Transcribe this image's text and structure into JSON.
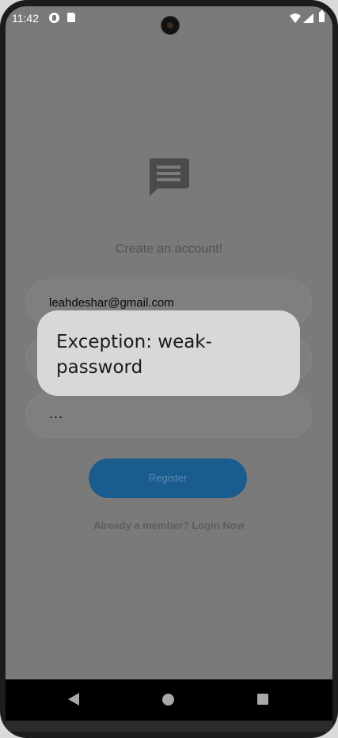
{
  "status_bar": {
    "time": "11:42"
  },
  "app": {
    "subtitle": "Create an account!",
    "fields": [
      {
        "value": "leahdeshar@gmail.com"
      },
      {
        "value": ""
      },
      {
        "value": "..."
      }
    ],
    "register_label": "Register",
    "login_prompt": "Already a member? Login Now"
  },
  "dialog": {
    "message": "Exception: weak-password"
  },
  "icons": {
    "logo": "chat-message-icon",
    "wifi": "wifi-icon",
    "cell": "cell-signal-icon",
    "battery": "battery-icon",
    "nav_back": "back-triangle-icon",
    "nav_home": "home-circle-icon",
    "nav_recents": "recents-square-icon"
  },
  "colors": {
    "scrim_background": "#7a7a7a",
    "dialog_background": "#d8d8d8",
    "register_button": "#1a5c8e",
    "nav_bar": "#000000"
  }
}
